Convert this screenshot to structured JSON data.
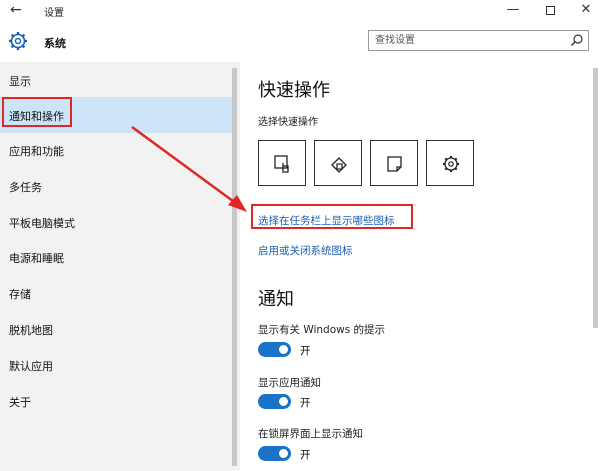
{
  "window": {
    "title": "设置",
    "back_glyph": "←",
    "minimize_glyph": "—",
    "close_glyph": "✕"
  },
  "header": {
    "title": "系统",
    "search_placeholder": "查找设置"
  },
  "sidebar": {
    "items": [
      {
        "label": "显示"
      },
      {
        "label": "通知和操作",
        "active": true
      },
      {
        "label": "应用和功能"
      },
      {
        "label": "多任务"
      },
      {
        "label": "平板电脑模式"
      },
      {
        "label": "电源和睡眠"
      },
      {
        "label": "存储"
      },
      {
        "label": "脱机地图"
      },
      {
        "label": "默认应用"
      },
      {
        "label": "关于"
      }
    ]
  },
  "main": {
    "quick_actions_title": "快速操作",
    "choose_quick_actions": "选择快速操作",
    "tiles": [
      {
        "icon": "tablet-mode-icon"
      },
      {
        "icon": "connect-icon"
      },
      {
        "icon": "note-icon"
      },
      {
        "icon": "settings-icon"
      }
    ],
    "link_taskbar_icons": "选择在任务栏上显示哪些图标",
    "link_system_icons": "启用或关闭系统图标",
    "notifications_title": "通知",
    "toggles": [
      {
        "label": "显示有关 Windows 的提示",
        "state": "开",
        "on": true
      },
      {
        "label": "显示应用通知",
        "state": "开",
        "on": true
      },
      {
        "label": "在锁屏界面上显示通知",
        "state": "开",
        "on": true
      }
    ]
  },
  "colors": {
    "accent": "#1a73c9",
    "link": "#1a5fb4",
    "highlight": "#e02626",
    "active_nav": "#cce4f7"
  }
}
